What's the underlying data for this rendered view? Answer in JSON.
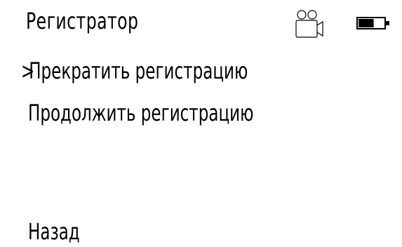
{
  "header": {
    "title": "Регистратор",
    "icons": [
      "camera-icon",
      "battery-icon"
    ]
  },
  "menu": {
    "cursor": ">",
    "selected_index": 0,
    "items": [
      {
        "label": "Прекратить регистрацию"
      },
      {
        "label": "Продолжить регистрацию"
      }
    ],
    "back_label": "Назад"
  },
  "battery": {
    "level": 0.6
  }
}
